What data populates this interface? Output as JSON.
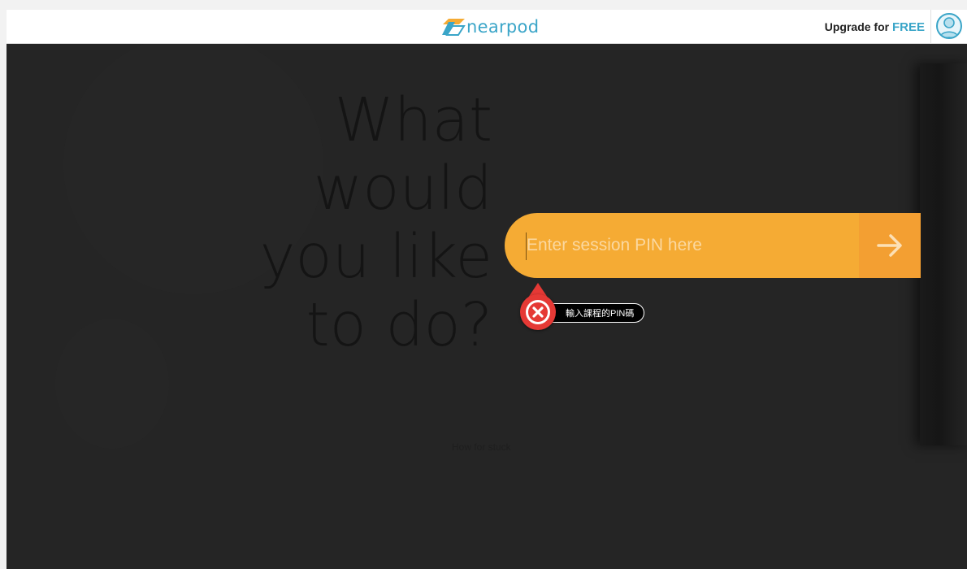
{
  "header": {
    "logo_text": "nearpod",
    "upgrade_prefix": "Upgrade for",
    "upgrade_highlight": "FREE",
    "avatar_icon": "user-avatar-icon"
  },
  "main": {
    "headline_lines": [
      "What",
      "would",
      "you like",
      "to do?"
    ],
    "hint_link": "How for stuck"
  },
  "pin_form": {
    "placeholder": "Enter session PIN here",
    "value": "",
    "submit_icon": "arrow-right-icon"
  },
  "error_tooltip": {
    "icon": "close-icon",
    "message": "輸入課程的PIN碼"
  },
  "colors": {
    "brand_teal": "#3aa5c8",
    "brand_orange": "#f5ab34",
    "submit_orange": "#f39f32",
    "error_red": "#e53935",
    "background": "#252525"
  }
}
